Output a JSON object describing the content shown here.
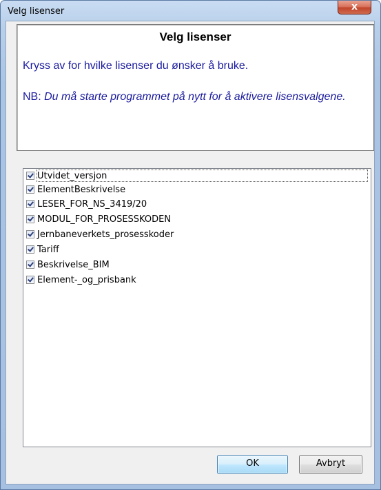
{
  "window": {
    "title": "Velg lisenser",
    "close_label": "x"
  },
  "info": {
    "heading": "Velg lisenser",
    "line1": "Kryss av for hvilke lisenser du ønsker å bruke.",
    "note_prefix": "NB: ",
    "note_text": "Du må starte programmet på nytt for å aktivere lisensvalgene."
  },
  "licenses": [
    {
      "label": "Utvidet_versjon",
      "checked": true
    },
    {
      "label": "ElementBeskrivelse",
      "checked": true
    },
    {
      "label": "LESER_FOR_NS_3419/20",
      "checked": true
    },
    {
      "label": "MODUL_FOR_PROSESSKODEN",
      "checked": true
    },
    {
      "label": "Jernbaneverkets_prosesskoder",
      "checked": true
    },
    {
      "label": "Tariff",
      "checked": true
    },
    {
      "label": "Beskrivelse_BIM",
      "checked": true
    },
    {
      "label": "Element-_og_prisbank",
      "checked": true
    }
  ],
  "buttons": {
    "ok": "OK",
    "cancel": "Avbryt"
  }
}
